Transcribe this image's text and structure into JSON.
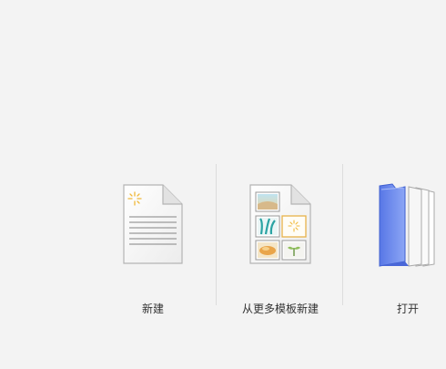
{
  "start_panel": {
    "tiles": [
      {
        "label": "新建",
        "icon": "blank-document-icon"
      },
      {
        "label": "从更多模板新建",
        "icon": "template-document-icon"
      },
      {
        "label": "打开",
        "icon": "folder-icon"
      }
    ]
  },
  "colors": {
    "background": "#f3f3f3",
    "label_text": "#333333",
    "divider": "#dcdcdc",
    "folder_blue": "#6f8ff0",
    "sparkle": "#f0b93b"
  }
}
